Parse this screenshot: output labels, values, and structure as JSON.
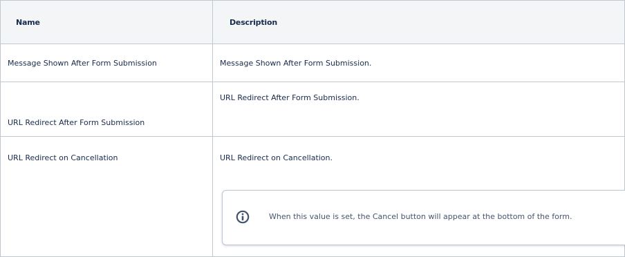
{
  "table": {
    "headers": {
      "name": "Name",
      "description": "Description"
    },
    "rows": [
      {
        "name": "Message Shown After Form Submission",
        "description": "Message Shown After Form Submission."
      },
      {
        "name": "URL Redirect After Form Submission",
        "description": "URL Redirect After Form Submission."
      },
      {
        "name": "URL Redirect on Cancellation",
        "description": "URL Redirect on Cancellation."
      }
    ]
  },
  "info_panel": {
    "icon": "info-icon",
    "text": "When this value is set, the Cancel button will appear at the bottom of the form."
  },
  "colors": {
    "header_bg": "#f4f5f7",
    "border": "#c1c7d0",
    "text": "#172b4d",
    "icon": "#44546f"
  }
}
